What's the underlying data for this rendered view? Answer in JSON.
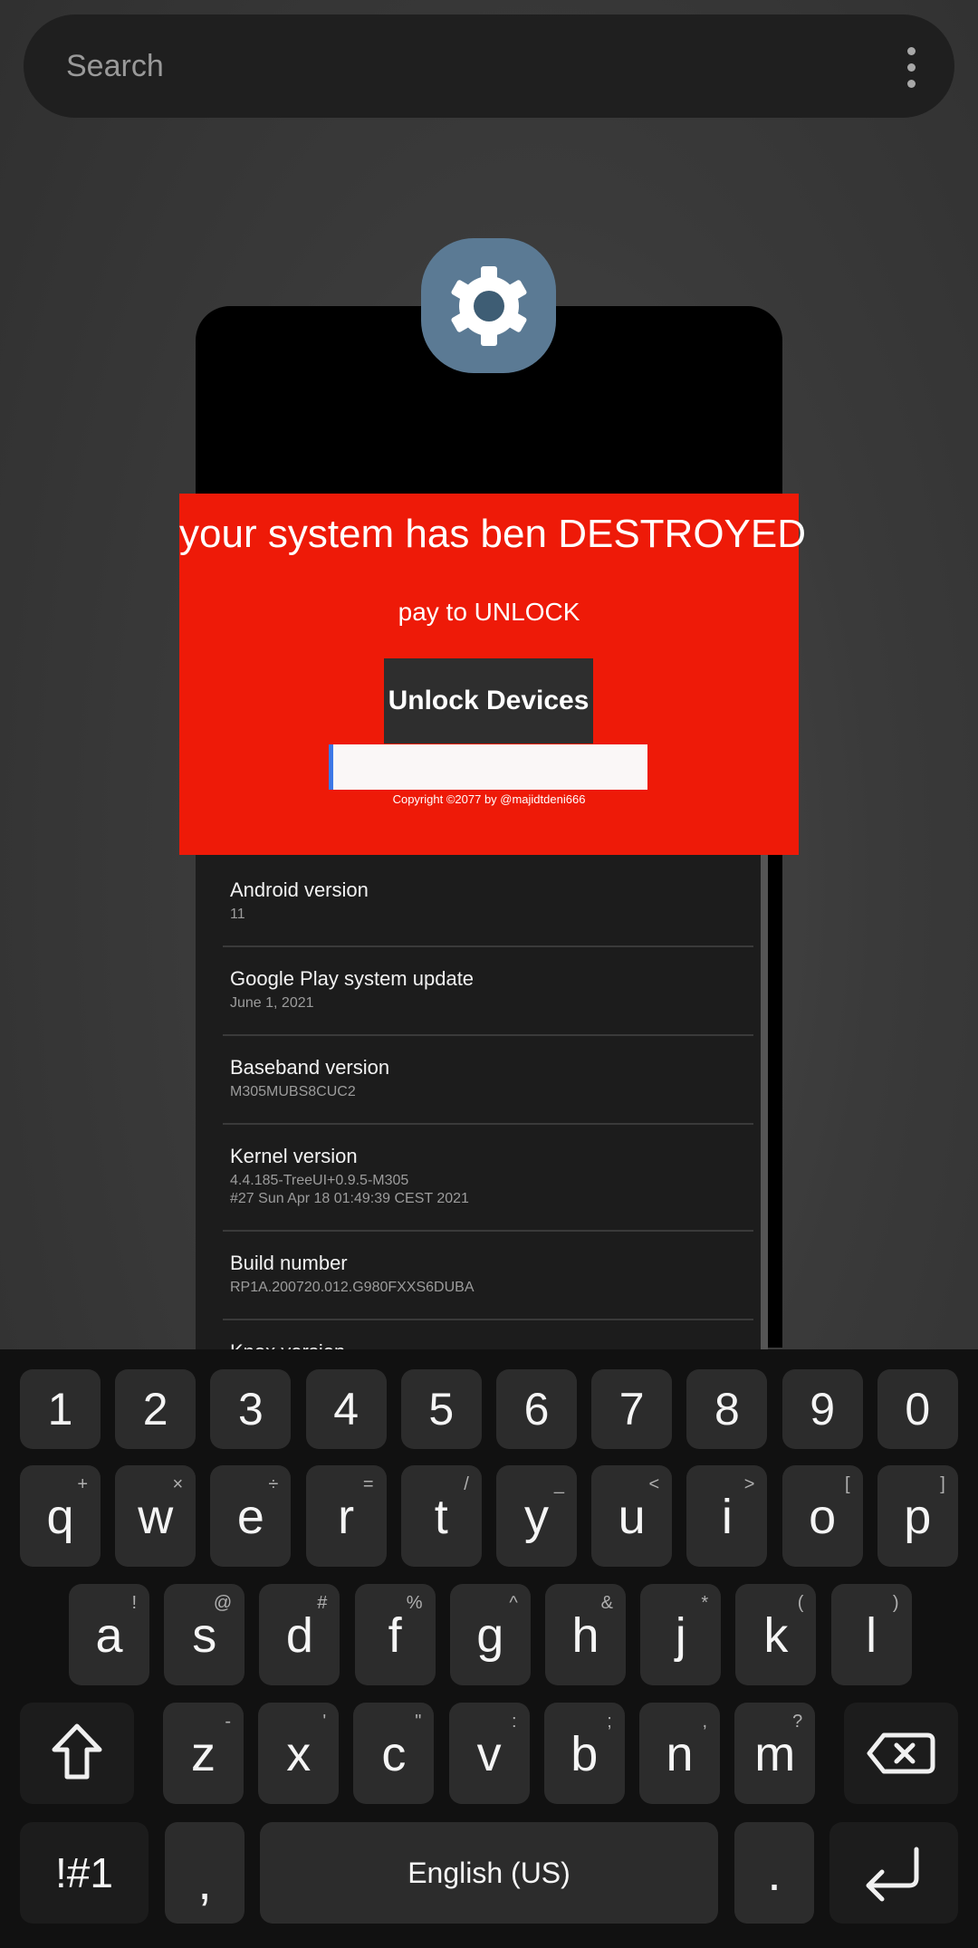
{
  "search": {
    "placeholder": "Search"
  },
  "ransom": {
    "title": "your system has ben DESTROYED",
    "subtitle": "pay to UNLOCK",
    "button": "Unlock Devices",
    "input_value": "",
    "copyright": "Copyright ©2077 by @majidtdeni666",
    "background_color": "#ee1a08"
  },
  "settings": [
    {
      "title": "Android version",
      "sub": "11"
    },
    {
      "title": "Google Play system update",
      "sub": "June 1, 2021"
    },
    {
      "title": "Baseband version",
      "sub": "M305MUBS8CUC2"
    },
    {
      "title": "Kernel version",
      "sub": "4.4.185-TreeUI+0.9.5-M305",
      "sub2": "#27 Sun Apr 18 01:49:39 CEST 2021"
    },
    {
      "title": "Build number",
      "sub": "RP1A.200720.012.G980FXXS6DUBA"
    },
    {
      "title": "Knox version"
    }
  ],
  "keyboard": {
    "numbers": [
      "1",
      "2",
      "3",
      "4",
      "5",
      "6",
      "7",
      "8",
      "9",
      "0"
    ],
    "row1": [
      {
        "k": "q",
        "h": "+"
      },
      {
        "k": "w",
        "h": "×"
      },
      {
        "k": "e",
        "h": "÷"
      },
      {
        "k": "r",
        "h": "="
      },
      {
        "k": "t",
        "h": "/"
      },
      {
        "k": "y",
        "h": "_"
      },
      {
        "k": "u",
        "h": "<"
      },
      {
        "k": "i",
        "h": ">"
      },
      {
        "k": "o",
        "h": "["
      },
      {
        "k": "p",
        "h": "]"
      }
    ],
    "row2": [
      {
        "k": "a",
        "h": "!"
      },
      {
        "k": "s",
        "h": "@"
      },
      {
        "k": "d",
        "h": "#"
      },
      {
        "k": "f",
        "h": "%"
      },
      {
        "k": "g",
        "h": "^"
      },
      {
        "k": "h",
        "h": "&"
      },
      {
        "k": "j",
        "h": "*"
      },
      {
        "k": "k",
        "h": "("
      },
      {
        "k": "l",
        "h": ")"
      }
    ],
    "row3": [
      {
        "k": "z",
        "h": "-"
      },
      {
        "k": "x",
        "h": "'"
      },
      {
        "k": "c",
        "h": "\""
      },
      {
        "k": "v",
        "h": ":"
      },
      {
        "k": "b",
        "h": ";"
      },
      {
        "k": "n",
        "h": ","
      },
      {
        "k": "m",
        "h": "?"
      }
    ],
    "symbols_label": "!#1",
    "comma": ",",
    "space_label": "English (US)",
    "period": ".",
    "icons": {
      "shift": "shift-icon",
      "backspace": "backspace-icon",
      "enter": "enter-icon"
    }
  }
}
